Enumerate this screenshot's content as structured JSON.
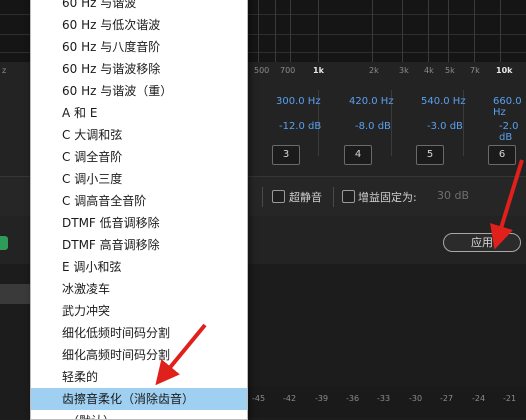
{
  "freq_axis": {
    "left_label": "z",
    "ticks": [
      "500",
      "700",
      "1k",
      "2k",
      "3k",
      "4k",
      "5k",
      "7k",
      "10k"
    ]
  },
  "bands": [
    {
      "freq": "300.0 Hz",
      "gain": "-12.0 dB",
      "num": "3"
    },
    {
      "freq": "420.0 Hz",
      "gain": "-8.0 dB",
      "num": "4"
    },
    {
      "freq": "540.0 Hz",
      "gain": "-3.0 dB",
      "num": "5"
    },
    {
      "freq": "660.0 Hz",
      "gain": "-2.0 dB",
      "num": "6"
    }
  ],
  "options": {
    "ultra_quiet": "超静音",
    "gain_fixed": "增益固定为:",
    "gain_value": "30 dB"
  },
  "apply_label": "应用",
  "bottom_ruler": [
    "-45",
    "-42",
    "-39",
    "-36",
    "-33",
    "-30",
    "-27",
    "-24",
    "-21"
  ],
  "menu": {
    "items": [
      "60 Hz 与谐波",
      "60 Hz 与低次谐波",
      "60 Hz 与八度音阶",
      "60 Hz 与谐波移除",
      "60 Hz 与谐波（重）",
      "A 和 E",
      "C 大调和弦",
      "C 调全音阶",
      "C 调小三度",
      "C 调高音全音阶",
      "DTMF 低音调移除",
      "DTMF 高音调移除",
      "E 调小和弦",
      "冰激凌车",
      "武力冲突",
      "细化低频时间码分割",
      "细化高频时间码分割",
      "轻柔的",
      "齿擦音柔化（消除齿音）",
      "（默认）"
    ],
    "selected_index": 18
  },
  "colors": {
    "accent_blue": "#5aa0f0",
    "selection": "#9fd0f2",
    "annotation_red": "#e0201b"
  }
}
